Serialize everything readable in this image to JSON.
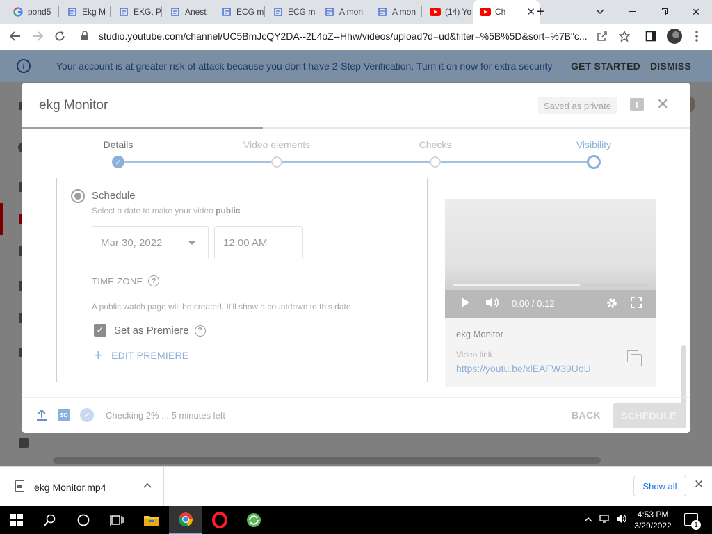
{
  "browser": {
    "tabs": [
      {
        "title": "pond5",
        "icon": "google-icon"
      },
      {
        "title": "Ekg M",
        "icon": "document-icon"
      },
      {
        "title": "EKG, P",
        "icon": "document-icon"
      },
      {
        "title": "Anest",
        "icon": "document-icon"
      },
      {
        "title": "ECG m",
        "icon": "document-icon"
      },
      {
        "title": "ECG m",
        "icon": "document-icon"
      },
      {
        "title": "A mon",
        "icon": "document-icon"
      },
      {
        "title": "A mon",
        "icon": "document-icon"
      },
      {
        "title": "(14) Yo",
        "icon": "youtube-icon"
      },
      {
        "title": "Ch",
        "icon": "youtube-icon",
        "active": true
      }
    ],
    "url": "studio.youtube.com/channel/UC5BmJcQY2DA--2L4oZ--Hhw/videos/upload?d=ud&filter=%5B%5D&sort=%7B\"c..."
  },
  "banner": {
    "message": "Your account is at greater risk of attack because you don't have 2-Step Verification. Turn it on now for extra security",
    "get_started": "GET STARTED",
    "dismiss": "DISMISS"
  },
  "dialog": {
    "title": "ekg Monitor",
    "saved_status": "Saved as private",
    "progress_fraction": 0.36,
    "steps": [
      {
        "label": "Details",
        "state": "done"
      },
      {
        "label": "Video elements",
        "state": "pending"
      },
      {
        "label": "Checks",
        "state": "pending"
      },
      {
        "label": "Visibility",
        "state": "current"
      }
    ],
    "schedule": {
      "label": "Schedule",
      "subtitle_prefix": "Select a date to make your video",
      "subtitle_bold": "public",
      "date": "Mar 30, 2022",
      "time": "12:00 AM",
      "time_zone": "TIME ZONE",
      "note": "A public watch page will be created. It'll show a countdown to this date.",
      "premiere_label": "Set as Premiere",
      "premiere_checked": true,
      "edit_premiere": "EDIT PREMIERE"
    },
    "preview": {
      "time": "0:00 / 0:12",
      "played_fraction": 0.0,
      "buffered_fraction": 0.65,
      "video_title": "ekg Monitor",
      "link_label": "Video link",
      "link": "https://youtu.be/xlEAFW39UoU"
    },
    "footer": {
      "status": "Checking 2% ... 5 minutes left",
      "back": "BACK",
      "schedule": "SCHEDULE",
      "sd_badge": "SD"
    }
  },
  "download_shelf": {
    "filename": "ekg Monitor.mp4",
    "show_all": "Show all"
  },
  "taskbar": {
    "time": "4:53 PM",
    "date": "3/29/2022",
    "notifications": "1"
  },
  "colors": {
    "accent": "#8ab0dc",
    "banner_bg": "#7a8fa3",
    "youtube_red": "#ff0000"
  }
}
